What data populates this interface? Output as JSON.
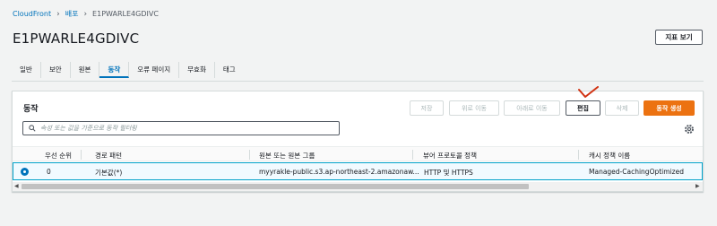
{
  "breadcrumb": {
    "root": "CloudFront",
    "section": "배포",
    "current": "E1PWARLE4GDIVC"
  },
  "page": {
    "title": "E1PWARLE4GDIVC",
    "metrics_button": "지표 보기"
  },
  "tabs": [
    "일반",
    "보안",
    "원본",
    "동작",
    "오류 페이지",
    "무효화",
    "태그"
  ],
  "active_tab": "동작",
  "behaviors": {
    "title": "동작",
    "buttons": {
      "save": "저장",
      "move_up": "위로 이동",
      "move_down": "아래로 이동",
      "edit": "편집",
      "delete": "삭제",
      "create": "동작 생성"
    },
    "search_placeholder": "속성 또는 값을 기준으로 동작 필터링",
    "columns": [
      "우선 순위",
      "경로 패턴",
      "원본 또는 원본 그룹",
      "뷰어 프로토콜 정책",
      "캐시 정책 이름"
    ],
    "rows": [
      {
        "selected": true,
        "priority": "0",
        "path": "기본값(*)",
        "origin": "myyrakle-public.s3.ap-northeast-2.amazonaw...",
        "viewer_protocol": "HTTP 및 HTTPS",
        "cache_policy": "Managed-CachingOptimized"
      }
    ]
  },
  "colors": {
    "link": "#0073bb",
    "primary": "#ec7211",
    "annotation": "#d13212"
  }
}
